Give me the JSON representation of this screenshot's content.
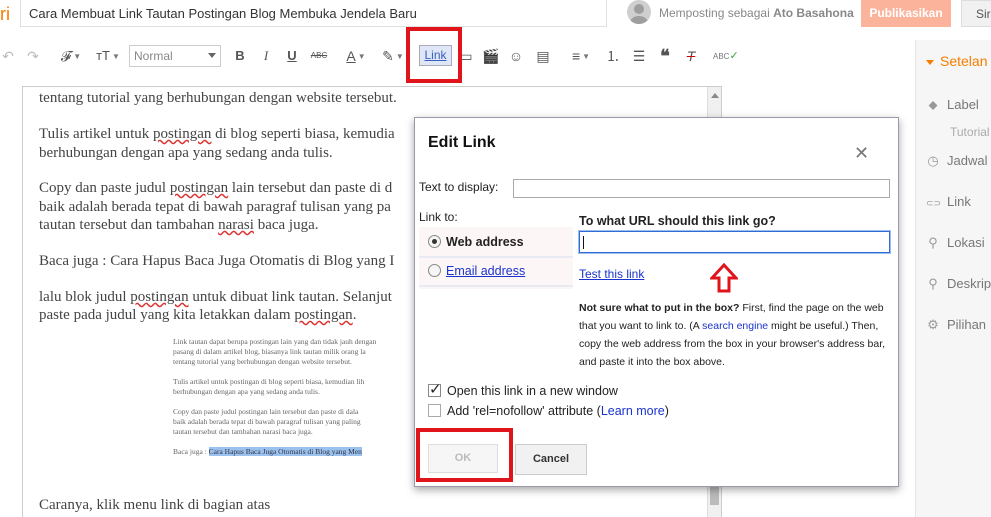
{
  "header": {
    "brand_tail": "ri",
    "post_title": "Cara Membuat Link Tautan Postingan Blog Membuka Jendela Baru",
    "posting_as_prefix": "Memposting sebagai",
    "posting_as_user": "Ato Basahona",
    "publish_label": "Publikasikan",
    "save_label": "Sir"
  },
  "toolbar": {
    "format_value": "Normal",
    "font_icon": "𝓕",
    "size_icon": "тT",
    "bold": "B",
    "italic": "I",
    "underline": "U",
    "strike": "ABC",
    "text_color": "A",
    "link_label": "Link",
    "spellcheck": "ABC"
  },
  "editor": {
    "lines": [
      {
        "pre": "tentang tutorial yang berhubungan dengan website tersebut.",
        "sq": "",
        "post": ""
      },
      {
        "pre": "Tulis artikel untuk ",
        "sq": "postingan",
        "post": " di blog seperti biasa, kemudia"
      },
      {
        "pre": "berhubungan dengan apa yang sedang anda tulis.",
        "sq": "",
        "post": ""
      },
      {
        "pre": "Copy dan paste judul ",
        "sq": "postingan",
        "post": " lain tersebut dan paste di d"
      },
      {
        "pre": "baik adalah berada tepat di bawah paragraf tulisan yang pa",
        "sq": "",
        "post": ""
      },
      {
        "pre": "tautan tersebut dan tambahan ",
        "sq": "narasi",
        "post": " baca juga."
      },
      {
        "pre": "Baca juga : Cara Hapus Baca Juga Otomatis di Blog yang I",
        "sq": "",
        "post": ""
      },
      {
        "pre": "lalu blok judul ",
        "sq": "postingan",
        "post": " untuk dibuat link tautan. Selanjut"
      },
      {
        "pre": "paste pada judul yang kita letakkan dalam ",
        "sq": "postingan",
        "post": "."
      },
      {
        "pre": "Caranya, klik menu link di bagian atas",
        "sq": "",
        "post": ""
      }
    ],
    "embedded": [
      {
        "text": "Link tautan dapat berupa postingan lain yang dan tidak jauh dengan",
        "hl": ""
      },
      {
        "text": "pasang di dalam artikel blog, biasanya link tautan milik orang la",
        "hl": ""
      },
      {
        "text": "tentang tutorial yang berhubungan dengan website tersebut.",
        "hl": ""
      },
      {
        "text": "Tulis artikel untuk postingan di blog seperti biasa, kemudian lih",
        "hl": ""
      },
      {
        "text": "berhubungan dengan apa yang sedang anda tulis.",
        "hl": ""
      },
      {
        "text": "Copy dan paste judul postingan lain tersebut dan paste di dala",
        "hl": ""
      },
      {
        "text": "baik adalah berada tepat di bawah paragraf tulisan yang paling",
        "hl": ""
      },
      {
        "text": "tautan tersebut dan tambahan narasi baca juga.",
        "hl": ""
      },
      {
        "text": "Baca juga : ",
        "hl": "Cara Hapus Baca Juga Otomatis di Blog yang Men"
      }
    ]
  },
  "sidebar": {
    "heading": "Setelan",
    "items": [
      {
        "icon": "label-icon",
        "glyph": "⬥",
        "label": "Label"
      },
      {
        "icon": "clock-icon",
        "glyph": "◷",
        "label": "Jadwal"
      },
      {
        "icon": "link-icon",
        "glyph": "⊂⊃",
        "label": "Link"
      },
      {
        "icon": "location-icon",
        "glyph": "⚲",
        "label": "Lokasi"
      },
      {
        "icon": "search-icon",
        "glyph": "⚲",
        "label": "Deskripsi"
      },
      {
        "icon": "gear-icon",
        "glyph": "⚙",
        "label": "Pilihan"
      }
    ],
    "sub": "Tutorial"
  },
  "dialog": {
    "title": "Edit Link",
    "close": "✕",
    "text_to_display_label": "Text to display:",
    "text_to_display_value": "",
    "link_to_label": "Link to:",
    "option_web": "Web address",
    "option_email": "Email address",
    "url_question": "To what URL should this link go?",
    "url_value": "",
    "test_link": "Test this link",
    "help_bold": "Not sure what to put in the box?",
    "help_1": " First, find the page on the web that you want to link to. (A ",
    "help_link": "search engine",
    "help_2": " might be useful.) Then, copy the web address from the box in your browser's address bar, and paste it into the box above.",
    "new_window_label": "Open this link in a new window",
    "nofollow_prefix": "Add 'rel=nofollow' attribute (",
    "learn_more": "Learn more",
    "nofollow_suffix": ")",
    "ok_label": "OK",
    "cancel_label": "Cancel"
  },
  "colors": {
    "highlight_red": "#e0151c",
    "brand_orange": "#f57d00",
    "link_blue": "#1a33cc"
  }
}
